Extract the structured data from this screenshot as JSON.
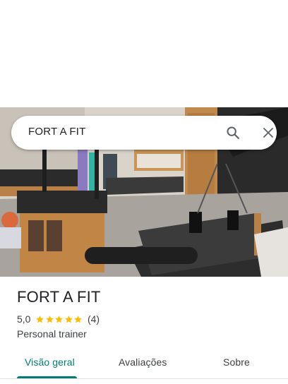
{
  "search": {
    "query": "FORT A FIT"
  },
  "place": {
    "name": "FORT A FIT",
    "rating": "5,0",
    "stars": 5,
    "review_count": "(4)",
    "category": "Personal trainer"
  },
  "tabs": [
    {
      "label": "Visão geral",
      "active": true
    },
    {
      "label": "Avaliações",
      "active": false
    },
    {
      "label": "Sobre",
      "active": false
    }
  ],
  "colors": {
    "accent": "#017d74",
    "star": "#fbbc04",
    "text": "#202124"
  },
  "icons": {
    "search": "search-icon",
    "close": "close-icon",
    "star": "star-icon"
  }
}
